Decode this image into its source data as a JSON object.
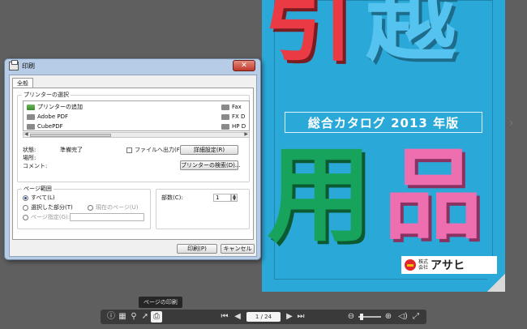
{
  "catalog": {
    "kanji_top_left": "引",
    "kanji_top_right": "越",
    "subtitle": "総合カタログ 2013 年版",
    "kanji_bottom_left": "用",
    "kanji_bottom_right": "品",
    "logo_small": "株式会社",
    "logo_name": "アサヒ"
  },
  "tooltip": "ページの印刷",
  "toolbar": {
    "icons": {
      "info": "ⓘ",
      "thumbnails": "▦",
      "search": "⚲",
      "share": "➚",
      "print": "⎙",
      "first": "⏮",
      "prev": "◀",
      "next": "▶",
      "last": "⏭",
      "zoom_out": "⊖",
      "zoom_in": "⊕",
      "audio": "◁)",
      "fullscreen": "⤢"
    },
    "page_indicator": "1 / 24"
  },
  "dialog": {
    "title": "印刷",
    "close_label": "✕",
    "tab_general": "全般",
    "select_printer_label": "プリンターの選択",
    "printers": {
      "add": "プリンターの追加",
      "adobe": "Adobe PDF",
      "cube": "CubePDF",
      "fax": "Fax",
      "fx": "FX D",
      "hp": "HP D"
    },
    "status_label": "状態:",
    "status_value": "準備完了",
    "location_label": "場所:",
    "comment_label": "コメント:",
    "print_to_file": "ファイルへ出力(F)",
    "preferences_button": "詳細設定(R)",
    "find_printer_button": "プリンターの検索(D)...",
    "page_range_label": "ページ範囲",
    "range_all": "すべて(L)",
    "range_selection": "選択した部分(T)",
    "range_current": "現在のページ(U)",
    "range_pages": "ページ指定(G):",
    "copies_label": "部数(C):",
    "copies_value": "1",
    "print_button": "印刷(P)",
    "cancel_button": "キャンセル"
  }
}
